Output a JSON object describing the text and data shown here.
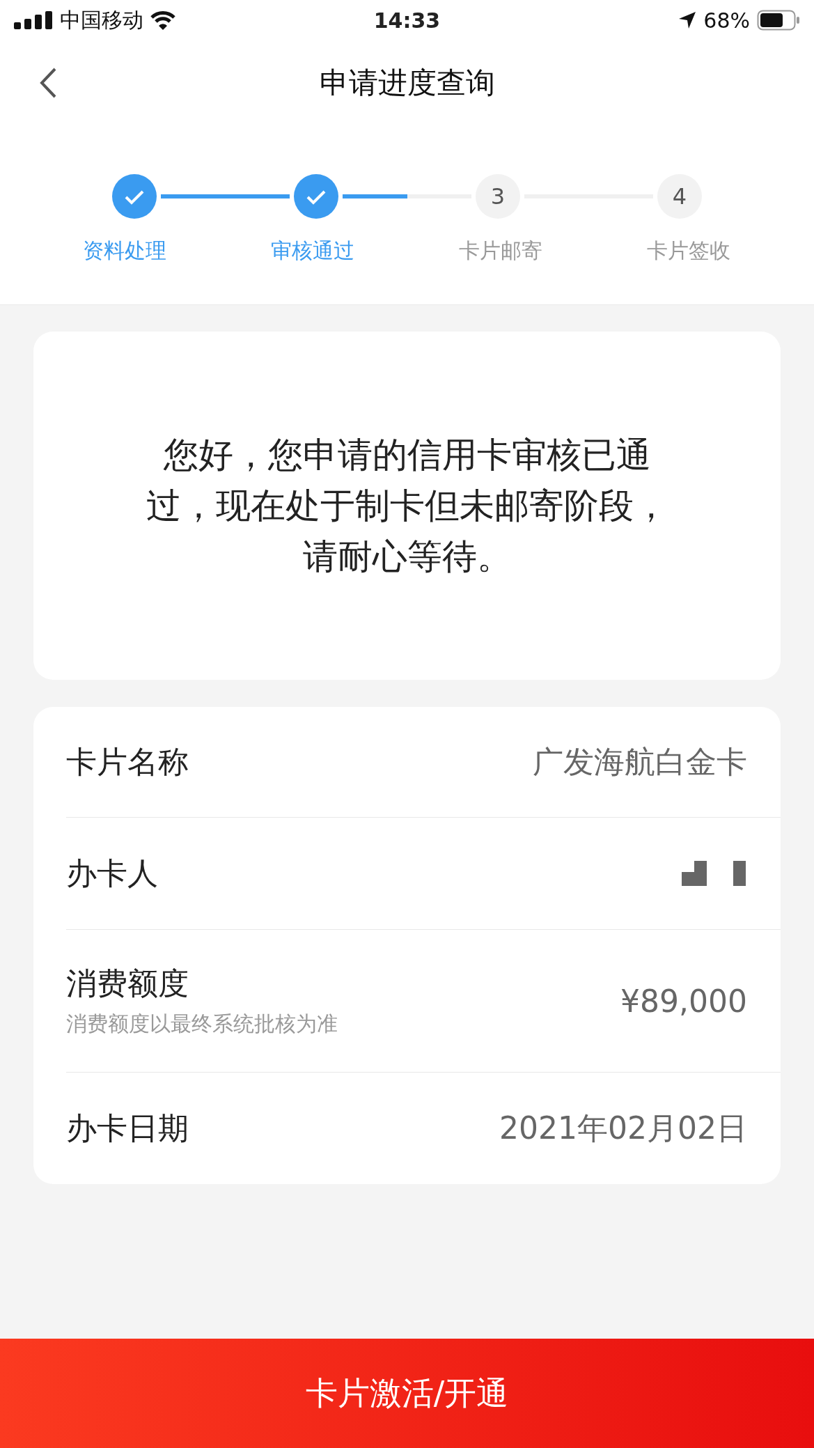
{
  "status_bar": {
    "carrier": "中国移动",
    "time": "14:33",
    "battery": "68%"
  },
  "nav": {
    "title": "申请进度查询"
  },
  "steps": [
    {
      "label": "资料处理",
      "done": true,
      "level": 1
    },
    {
      "label": "审核通过",
      "done": true,
      "level": 0.5
    },
    {
      "label": "卡片邮寄",
      "done": false,
      "number": "3"
    },
    {
      "label": "卡片签收",
      "done": false,
      "number": "4"
    }
  ],
  "message": "您好，您申请的信用卡审核已通过，现在处于制卡但未邮寄阶段，请耐心等待。",
  "details": [
    {
      "kind": "text",
      "label": "卡片名称",
      "value": "广发海航白金卡"
    },
    {
      "kind": "redacted",
      "label": "办卡人"
    },
    {
      "kind": "text",
      "label": "消费额度",
      "note": "消费额度以最终系统批核为准",
      "value": "¥89,000"
    },
    {
      "kind": "text",
      "label": "办卡日期",
      "value": "2021年02月02日"
    }
  ],
  "action_button": "卡片激活/开通"
}
